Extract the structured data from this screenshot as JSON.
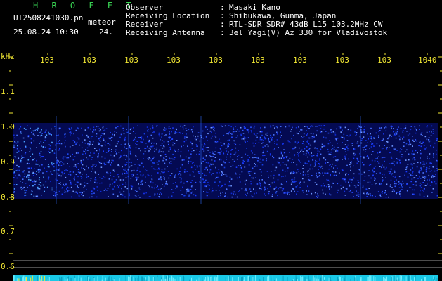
{
  "header": {
    "title": "H R O F F T",
    "filename": "UT2508241030.pn",
    "mode": "meteor",
    "datetime": "25.08.24 10:30",
    "count": "24."
  },
  "info": [
    {
      "label": "Observer",
      "colon": ":",
      "value": "Masaki Kano"
    },
    {
      "label": "Receiving Location",
      "colon": ":",
      "value": "Shibukawa, Gunma, Japan"
    },
    {
      "label": "Receiver",
      "colon": ":",
      "value": "RTL-SDR SDR# 43dB L15 103.2MHz CW"
    },
    {
      "label": "Receiving Antenna",
      "colon": ":",
      "value": "3el Yagi(V) Az 330 for Vladivostok"
    }
  ],
  "axis": {
    "unit": "kHz",
    "x_ticks": [
      "103",
      "103",
      "103",
      "103",
      "103",
      "103",
      "103",
      "103",
      "103",
      "1040"
    ],
    "y_ticks": [
      "1.1",
      "1.0",
      "0.9",
      "0.8",
      "0.7",
      "0.6"
    ]
  },
  "colors": {
    "title": "#39d353",
    "ticks": "#f2e833",
    "signal_band": "#1a3bff",
    "noise_strip": "#19c8e6"
  }
}
